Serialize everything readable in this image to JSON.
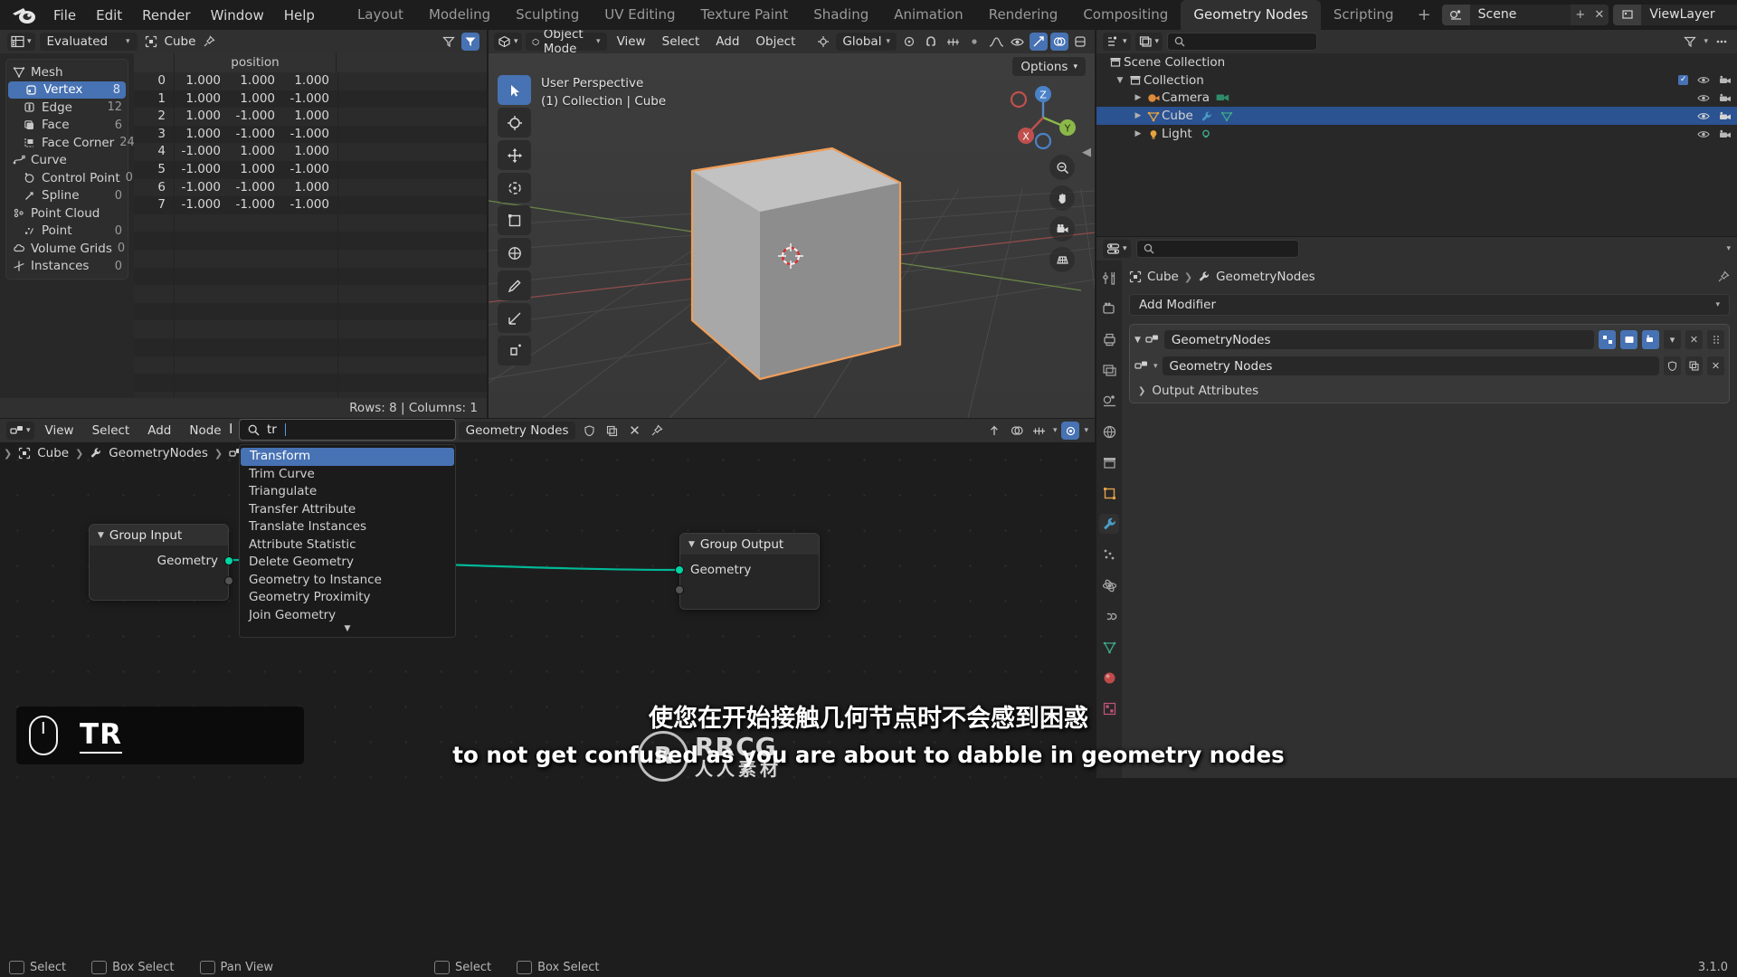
{
  "topbar": {
    "app_icon": "blender-logo",
    "menus": [
      "File",
      "Edit",
      "Render",
      "Window",
      "Help"
    ],
    "workspaces": [
      {
        "label": "Layout",
        "active": false
      },
      {
        "label": "Modeling",
        "active": false
      },
      {
        "label": "Sculpting",
        "active": false
      },
      {
        "label": "UV Editing",
        "active": false
      },
      {
        "label": "Texture Paint",
        "active": false
      },
      {
        "label": "Shading",
        "active": false
      },
      {
        "label": "Animation",
        "active": false
      },
      {
        "label": "Rendering",
        "active": false
      },
      {
        "label": "Compositing",
        "active": false
      },
      {
        "label": "Geometry Nodes",
        "active": true
      },
      {
        "label": "Scripting",
        "active": false
      }
    ],
    "add_workspace": "+",
    "scene_name": "Scene",
    "viewlayer_name": "ViewLayer"
  },
  "spreadsheet": {
    "editor_type_icon": "spreadsheet-editor-icon",
    "dataset_mode": "Evaluated",
    "object_name": "Cube",
    "pin_icon": "pin-icon",
    "filter_icon": "filter-icon",
    "sidebar": [
      {
        "label": "Mesh",
        "count": "",
        "icon": "mesh-data-icon",
        "indent": false,
        "selected": false
      },
      {
        "label": "Vertex",
        "count": "8",
        "icon": "vertex-icon",
        "indent": true,
        "selected": true
      },
      {
        "label": "Edge",
        "count": "12",
        "icon": "edge-icon",
        "indent": true,
        "selected": false
      },
      {
        "label": "Face",
        "count": "6",
        "icon": "face-icon",
        "indent": true,
        "selected": false
      },
      {
        "label": "Face Corner",
        "count": "24",
        "icon": "face-corner-icon",
        "indent": true,
        "selected": false
      },
      {
        "label": "Curve",
        "count": "",
        "icon": "curve-data-icon",
        "indent": false,
        "selected": false
      },
      {
        "label": "Control Point",
        "count": "0",
        "icon": "control-point-icon",
        "indent": true,
        "selected": false
      },
      {
        "label": "Spline",
        "count": "0",
        "icon": "spline-icon",
        "indent": true,
        "selected": false
      },
      {
        "label": "Point Cloud",
        "count": "",
        "icon": "pointcloud-icon",
        "indent": false,
        "selected": false
      },
      {
        "label": "Point",
        "count": "0",
        "icon": "point-icon",
        "indent": true,
        "selected": false
      },
      {
        "label": "Volume Grids",
        "count": "0",
        "icon": "volume-icon",
        "indent": false,
        "selected": false
      },
      {
        "label": "Instances",
        "count": "0",
        "icon": "instances-icon",
        "indent": false,
        "selected": false
      }
    ],
    "column_group": "position",
    "rows": [
      {
        "index": "0",
        "values": [
          "1.000",
          "1.000",
          "1.000"
        ]
      },
      {
        "index": "1",
        "values": [
          "1.000",
          "1.000",
          "-1.000"
        ]
      },
      {
        "index": "2",
        "values": [
          "1.000",
          "-1.000",
          "1.000"
        ]
      },
      {
        "index": "3",
        "values": [
          "1.000",
          "-1.000",
          "-1.000"
        ]
      },
      {
        "index": "4",
        "values": [
          "-1.000",
          "1.000",
          "1.000"
        ]
      },
      {
        "index": "5",
        "values": [
          "-1.000",
          "1.000",
          "-1.000"
        ]
      },
      {
        "index": "6",
        "values": [
          "-1.000",
          "-1.000",
          "1.000"
        ]
      },
      {
        "index": "7",
        "values": [
          "-1.000",
          "-1.000",
          "-1.000"
        ]
      }
    ],
    "footer": "Rows: 8  |  Columns: 1"
  },
  "viewport": {
    "editor_type_icon": "3d-viewport-icon",
    "mode": "Object Mode",
    "menus": [
      "View",
      "Select",
      "Add",
      "Object"
    ],
    "transform_orientation": "Global",
    "snap_icon": "magnet-icon",
    "proportional_icon": "proportional-edit-icon",
    "options_label": "Options",
    "overlay_text_line1": "User Perspective",
    "overlay_text_line2": "(1) Collection | Cube",
    "gizmo_axes": [
      "X",
      "Y",
      "Z"
    ],
    "tools": [
      {
        "name": "select-box-tool",
        "active": true
      },
      {
        "name": "cursor-tool",
        "active": false
      },
      {
        "name": "move-tool",
        "active": false
      },
      {
        "name": "rotate-tool",
        "active": false
      },
      {
        "name": "scale-tool",
        "active": false
      },
      {
        "name": "transform-tool",
        "active": false
      },
      {
        "name": "annotate-tool",
        "active": false
      },
      {
        "name": "measure-tool",
        "active": false
      },
      {
        "name": "add-cube-tool",
        "active": false
      }
    ],
    "nav_buttons": [
      "zoom-icon",
      "hand-pan-icon",
      "camera-view-icon",
      "ortho-persp-icon"
    ]
  },
  "outliner": {
    "display_mode_icon": "outliner-icon",
    "filter_icon": "filter-icon",
    "search_placeholder": "",
    "rows": [
      {
        "label": "Scene Collection",
        "icon": "collection-icon",
        "depth": 0,
        "expand": "",
        "selected": false,
        "visible": true
      },
      {
        "label": "Collection",
        "icon": "collection-icon",
        "depth": 1,
        "expand": "▼",
        "selected": false,
        "visible": true,
        "checkbox": true
      },
      {
        "label": "Camera",
        "icon": "camera-icon",
        "depth": 2,
        "expand": "▶",
        "selected": false,
        "visible": true
      },
      {
        "label": "Cube",
        "icon": "mesh-icon",
        "depth": 2,
        "expand": "▶",
        "selected": true,
        "visible": true
      },
      {
        "label": "Light",
        "icon": "light-icon",
        "depth": 2,
        "expand": "▶",
        "selected": false,
        "visible": true
      }
    ]
  },
  "properties": {
    "editor_type_icon": "properties-icon",
    "search_placeholder": "",
    "breadcrumb": [
      "Cube",
      "GeometryNodes"
    ],
    "add_modifier_label": "Add Modifier",
    "modifier_name": "GeometryNodes",
    "nodegroup_label": "Geometry Nodes",
    "output_attributes_label": "Output Attributes",
    "tabs": [
      {
        "name": "tool-tab",
        "icon": "tool-icon",
        "active": false
      },
      {
        "name": "render-tab",
        "icon": "render-icon",
        "active": false
      },
      {
        "name": "output-tab",
        "icon": "printer-icon",
        "active": false
      },
      {
        "name": "viewlayer-tab",
        "icon": "images-icon",
        "active": false
      },
      {
        "name": "scene-tab",
        "icon": "scene-icon",
        "active": false
      },
      {
        "name": "world-tab",
        "icon": "world-icon",
        "active": false
      },
      {
        "name": "collection-tab",
        "icon": "collection-props-icon",
        "active": false
      },
      {
        "name": "object-tab",
        "icon": "object-icon",
        "active": false
      },
      {
        "name": "modifier-tab",
        "icon": "wrench-icon",
        "active": true
      },
      {
        "name": "particles-tab",
        "icon": "particles-icon",
        "active": false
      },
      {
        "name": "physics-tab",
        "icon": "physics-icon",
        "active": false
      },
      {
        "name": "constraints-tab",
        "icon": "constraints-icon",
        "active": false
      },
      {
        "name": "data-tab",
        "icon": "mesh-data-tab-icon",
        "active": false
      },
      {
        "name": "material-tab",
        "icon": "material-icon",
        "active": false
      },
      {
        "name": "texture-tab",
        "icon": "texture-icon",
        "active": false
      }
    ]
  },
  "node_editor": {
    "editor_type_icon": "geometry-nodes-editor-icon",
    "menus": [
      "View",
      "Select",
      "Add",
      "Node"
    ],
    "nodetree_name": "Geometry Nodes",
    "breadcrumb": [
      "Cube",
      "GeometryNodes"
    ],
    "nodes": [
      {
        "title": "Group Input",
        "sockets_out": [
          "Geometry"
        ],
        "extra_socket": true
      },
      {
        "title": "Group Output",
        "sockets_in": [
          "Geometry"
        ],
        "extra_socket": true
      }
    ],
    "search": {
      "query": "tr",
      "search_icon": "search-icon",
      "results": [
        {
          "label": "Transform",
          "selected": true
        },
        {
          "label": "Trim Curve",
          "selected": false
        },
        {
          "label": "Triangulate",
          "selected": false
        },
        {
          "label": "Transfer Attribute",
          "selected": false
        },
        {
          "label": "Translate Instances",
          "selected": false
        },
        {
          "label": "Attribute Statistic",
          "selected": false
        },
        {
          "label": "Delete Geometry",
          "selected": false
        },
        {
          "label": "Geometry to Instance",
          "selected": false
        },
        {
          "label": "Geometry Proximity",
          "selected": false
        },
        {
          "label": "Join Geometry",
          "selected": false
        }
      ],
      "more_indicator": "▼"
    }
  },
  "key_overlay": {
    "mouse_icon": "mouse-icon",
    "key_label": "TR"
  },
  "subtitles": {
    "chinese": "使您在开始接触几何节点时不会感到困惑",
    "english": "to not get confused as you are about to dabble in geometry nodes"
  },
  "watermark": {
    "logo_text": "R",
    "line1": "RRCG",
    "line2": "人人素材"
  },
  "statusbar": {
    "items": [
      {
        "key": "mouse-left-icon",
        "label": "Select"
      },
      {
        "key": "mouse-left-drag-icon",
        "label": "Box Select"
      },
      {
        "key": "mouse-middle-icon",
        "label": "Pan View"
      },
      {
        "key": "mouse-left-icon-2",
        "label": "Select"
      },
      {
        "key": "mouse-left-drag-icon-2",
        "label": "Box Select"
      }
    ],
    "version": "3.1.0"
  },
  "colors": {
    "accent_blue": "#4772b3",
    "geometry_socket": "#00d6a3",
    "selected_outline": "#ed9e5c",
    "panel_bg": "#303030",
    "editor_bg": "#282828"
  }
}
